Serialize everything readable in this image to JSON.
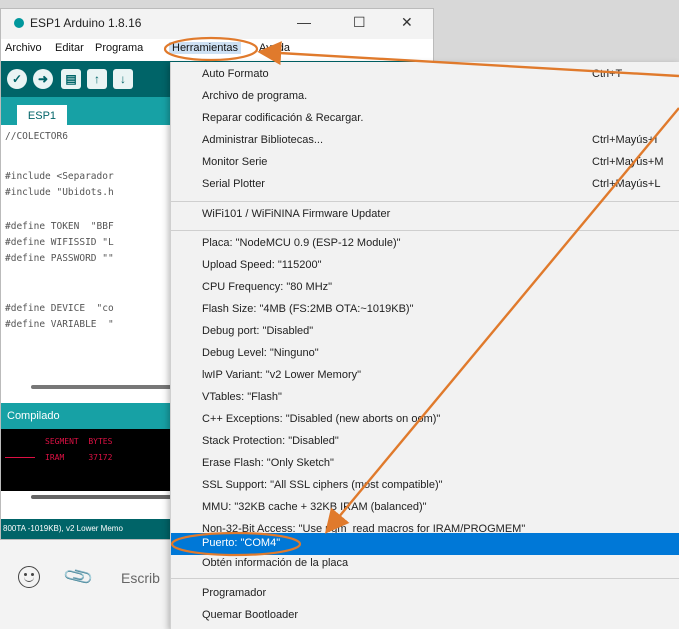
{
  "window": {
    "title": "ESP1 Arduino 1.8.16",
    "minimize": "—",
    "maximize": "☐",
    "close": "✕"
  },
  "menubar": [
    "Archivo",
    "Editar",
    "Programa",
    "Herramientas",
    "Ayuda"
  ],
  "toolbar": {
    "verify_icon": "check-icon",
    "upload_icon": "arrow-right-icon",
    "new_icon": "new-file-icon",
    "open_icon": "up-arrow-icon",
    "save_icon": "down-arrow-icon"
  },
  "tab": "ESP1",
  "code": [
    "//COLECTOR6",
    "",
    "#include <Separador",
    "#include \"Ubidots.h",
    "",
    "#define TOKEN  \"BBF",
    "#define WIFISSID \"L",
    "#define PASSWORD \"\"",
    "",
    "",
    "#define DEVICE  \"co",
    "#define VARIABLE  \""
  ],
  "console": {
    "header": "Compilado",
    "lines": [
      "SEGMENT  BYTES",
      "IRAM     37172"
    ]
  },
  "statusbar": "800TA -1019KB), v2 Lower Memo",
  "chat": {
    "placeholder": "Escrib"
  },
  "menu": {
    "items": [
      {
        "label": "Auto Formato",
        "shortcut": "Ctrl+T"
      },
      {
        "label": "Archivo de programa.",
        "shortcut": ""
      },
      {
        "label": "Reparar codificación & Recargar.",
        "shortcut": ""
      },
      {
        "label": "Administrar Bibliotecas...",
        "shortcut": "Ctrl+Mayús+I"
      },
      {
        "label": "Monitor Serie",
        "shortcut": "Ctrl+Mayús+M"
      },
      {
        "label": "Serial Plotter",
        "shortcut": "Ctrl+Mayús+L"
      },
      {
        "label": "WiFi101 / WiFiNINA Firmware Updater",
        "shortcut": ""
      },
      {
        "label": "Placa: \"NodeMCU 0.9 (ESP-12 Module)\"",
        "shortcut": ""
      },
      {
        "label": "Upload Speed: \"115200\"",
        "shortcut": ""
      },
      {
        "label": "CPU Frequency: \"80 MHz\"",
        "shortcut": ""
      },
      {
        "label": "Flash Size: \"4MB (FS:2MB OTA:~1019KB)\"",
        "shortcut": ""
      },
      {
        "label": "Debug port: \"Disabled\"",
        "shortcut": ""
      },
      {
        "label": "Debug Level: \"Ninguno\"",
        "shortcut": ""
      },
      {
        "label": "lwIP Variant: \"v2 Lower Memory\"",
        "shortcut": ""
      },
      {
        "label": "VTables: \"Flash\"",
        "shortcut": ""
      },
      {
        "label": "C++ Exceptions: \"Disabled (new aborts on oom)\"",
        "shortcut": ""
      },
      {
        "label": "Stack Protection: \"Disabled\"",
        "shortcut": ""
      },
      {
        "label": "Erase Flash: \"Only Sketch\"",
        "shortcut": ""
      },
      {
        "label": "SSL Support: \"All SSL ciphers (most compatible)\"",
        "shortcut": ""
      },
      {
        "label": "MMU: \"32KB cache + 32KB IRAM (balanced)\"",
        "shortcut": ""
      },
      {
        "label": "Non-32-Bit Access: \"Use pgm_read macros for IRAM/PROGMEM\"",
        "shortcut": ""
      },
      {
        "label": "Puerto: \"COM4\"",
        "shortcut": ""
      },
      {
        "label": "Obtén información de la placa",
        "shortcut": ""
      },
      {
        "label": "Programador",
        "shortcut": ""
      },
      {
        "label": "Quemar Bootloader",
        "shortcut": ""
      }
    ],
    "selected": "Puerto: \"COM4\""
  },
  "colors": {
    "arduino_teal": "#006468",
    "arduino_tab": "#17a1a5",
    "selection_blue": "#0078d7",
    "annotation_orange": "#e07a2c"
  }
}
